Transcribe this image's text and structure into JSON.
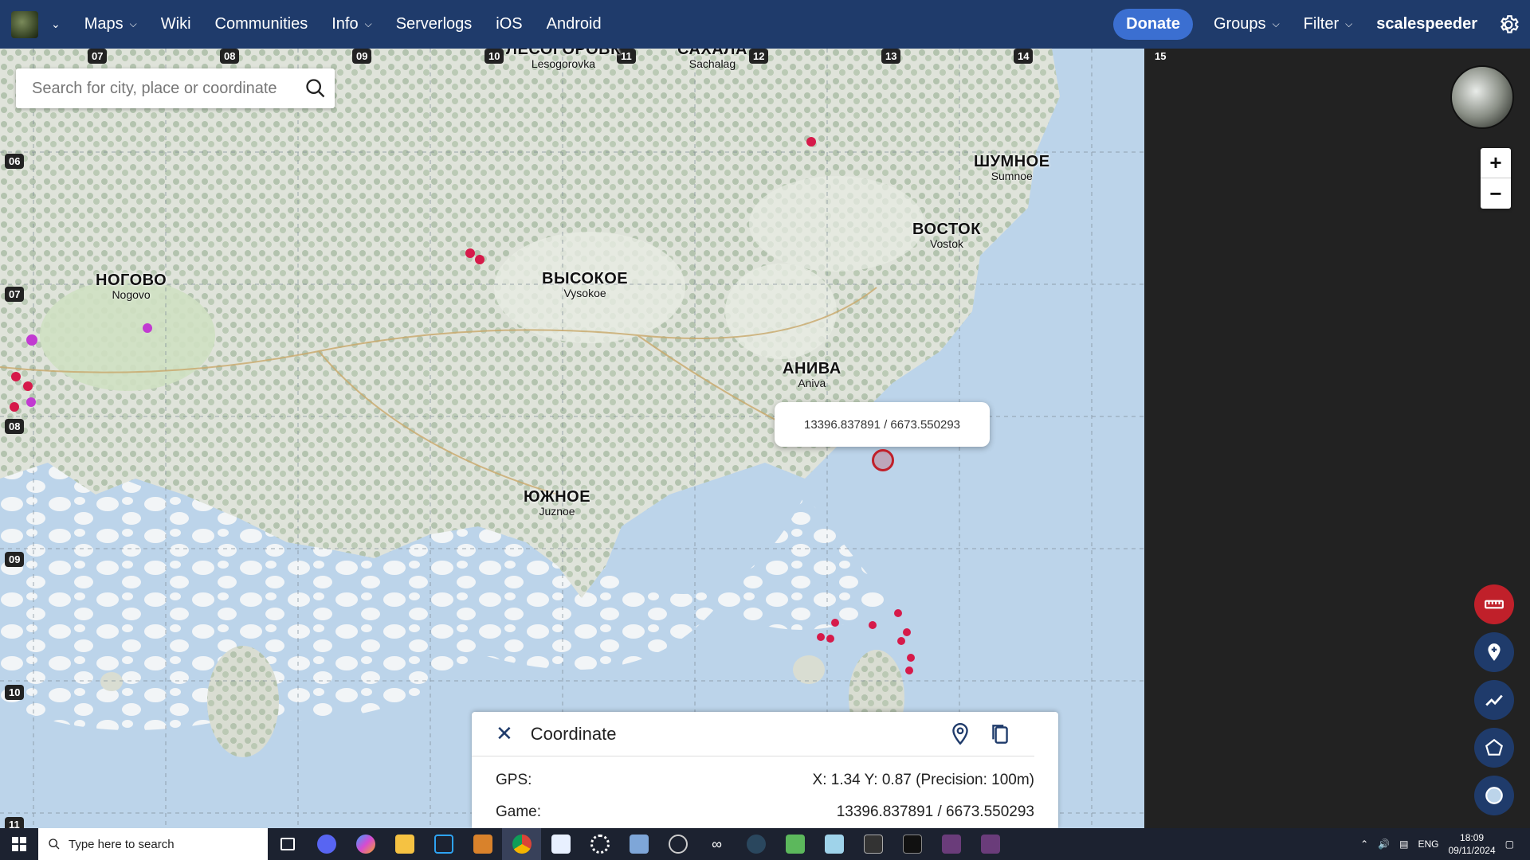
{
  "nav": {
    "items": [
      {
        "label": "Maps",
        "dropdown": true
      },
      {
        "label": "Wiki",
        "dropdown": false
      },
      {
        "label": "Communities",
        "dropdown": false
      },
      {
        "label": "Info",
        "dropdown": true
      },
      {
        "label": "Serverlogs",
        "dropdown": false
      },
      {
        "label": "iOS",
        "dropdown": false
      },
      {
        "label": "Android",
        "dropdown": false
      }
    ],
    "donate": "Donate",
    "groups": "Groups",
    "filter": "Filter",
    "username": "scalespeeder",
    "colors": {
      "navbar": "#1f3b6b",
      "donate": "#3b6fd1"
    }
  },
  "search": {
    "placeholder": "Search for city, place or coordinate"
  },
  "grid": {
    "columns": [
      "07",
      "08",
      "09",
      "10",
      "11",
      "12",
      "13",
      "14",
      "15"
    ],
    "rows": [
      "06",
      "07",
      "08",
      "09",
      "10",
      "11"
    ]
  },
  "towns": [
    {
      "ru": "НОГОВО",
      "en": "Nogovo"
    },
    {
      "ru": "ВЫСОКОЕ",
      "en": "Vysokoe"
    },
    {
      "ru": "ШУМНОЕ",
      "en": "Sumnoe"
    },
    {
      "ru": "ВОСТОК",
      "en": "Vostok"
    },
    {
      "ru": "АНИВА",
      "en": "Aniva"
    },
    {
      "ru": "ЮЖНОЕ",
      "en": "Juznoe"
    },
    {
      "ru": "ЛЕСОГОРОВК",
      "en": "Lesogorovka"
    },
    {
      "ru": "САХАЛА",
      "en": "Sachalag"
    }
  ],
  "popup": {
    "text": "13396.837891 / 6673.550293"
  },
  "coordinate_panel": {
    "title": "Coordinate",
    "gps_label": "GPS:",
    "gps_value": "X: 1.34 Y:  0.87 (Precision:  100m)",
    "game_label": "Game:",
    "game_value": "13396.837891 / 6673.550293"
  },
  "zoom": {
    "in": "+",
    "out": "−"
  },
  "tools": [
    "ruler-icon",
    "add-marker-icon",
    "polyline-icon",
    "polygon-icon",
    "circle-icon"
  ],
  "taskbar": {
    "search_placeholder": "Type here to search",
    "language": "ENG",
    "time": "18:09",
    "date": "09/11/2024"
  }
}
